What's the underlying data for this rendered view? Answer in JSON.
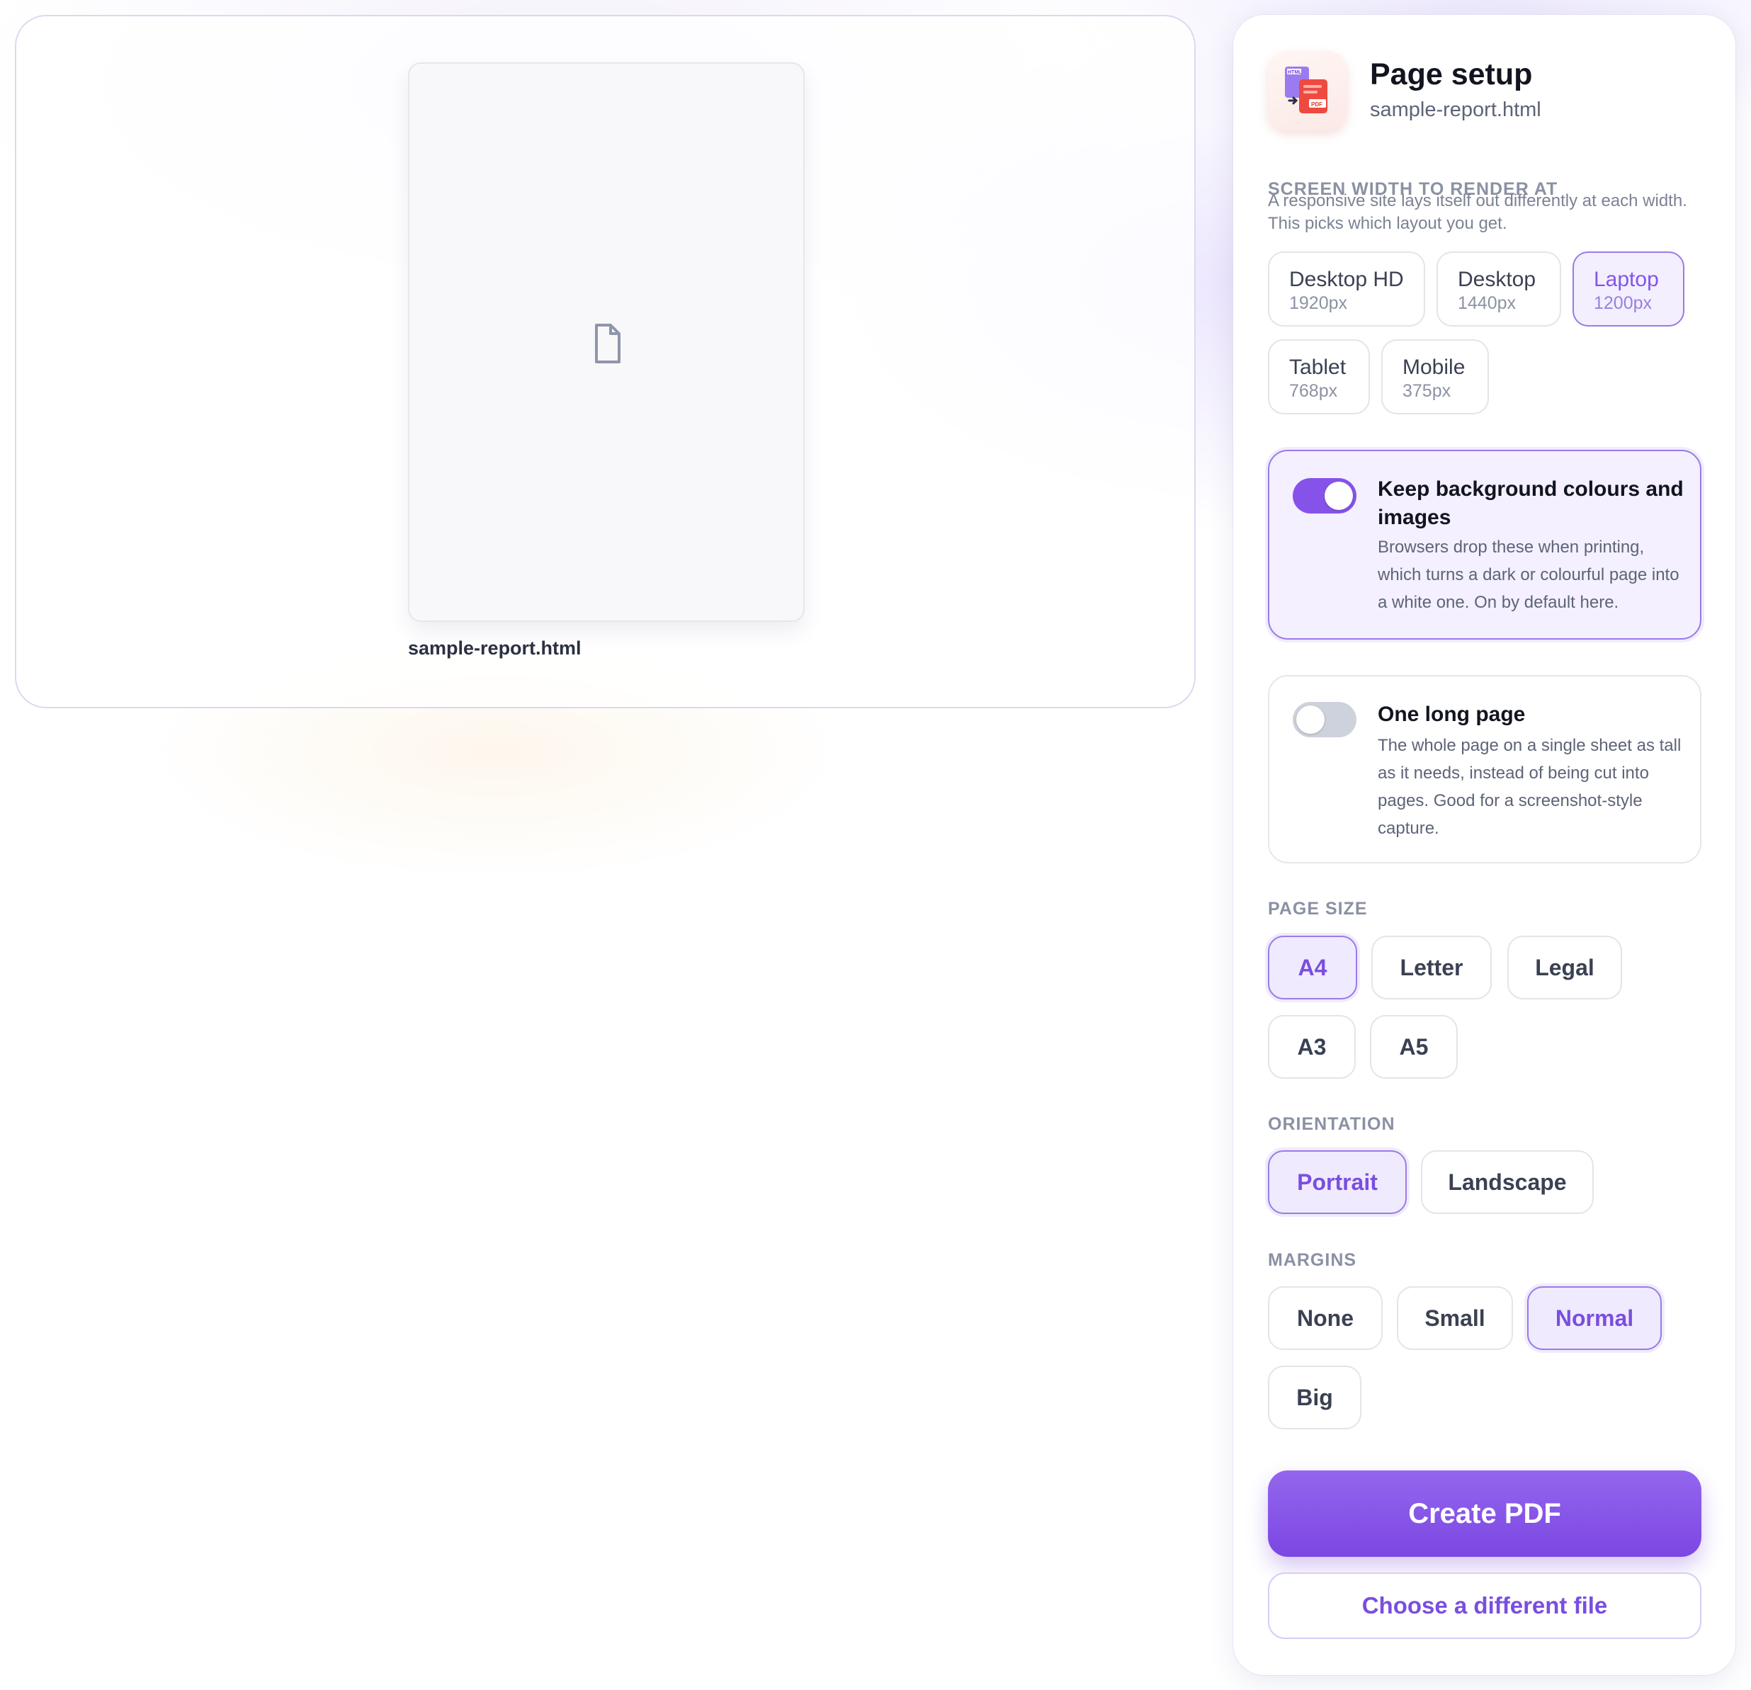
{
  "preview": {
    "filename": "sample-report.html"
  },
  "panel": {
    "title": "Page setup",
    "filename": "sample-report.html"
  },
  "screen_width": {
    "label": "SCREEN WIDTH TO RENDER AT",
    "help": "A responsive site lays itself out differently at each width. This picks which layout you get.",
    "options": [
      {
        "name": "Desktop HD",
        "px": "1920px",
        "selected": false
      },
      {
        "name": "Desktop",
        "px": "1440px",
        "selected": false
      },
      {
        "name": "Laptop",
        "px": "1200px",
        "selected": true
      },
      {
        "name": "Tablet",
        "px": "768px",
        "selected": false
      },
      {
        "name": "Mobile",
        "px": "375px",
        "selected": false
      }
    ]
  },
  "keep_background": {
    "title": "Keep background colours and images",
    "desc": "Browsers drop these when printing, which turns a dark or colourful page into a white one. On by default here.",
    "on": true
  },
  "one_long_page": {
    "title": "One long page",
    "desc": "The whole page on a single sheet as tall as it needs, instead of being cut into pages. Good for a screenshot-style capture.",
    "on": false
  },
  "page_size": {
    "label": "PAGE SIZE",
    "options": [
      "A4",
      "Letter",
      "Legal",
      "A3",
      "A5"
    ],
    "selected": "A4"
  },
  "orientation": {
    "label": "ORIENTATION",
    "options": [
      "Portrait",
      "Landscape"
    ],
    "selected": "Portrait"
  },
  "margins": {
    "label": "MARGINS",
    "options": [
      "None",
      "Small",
      "Normal",
      "Big"
    ],
    "selected": "Normal"
  },
  "actions": {
    "create": "Create PDF",
    "choose": "Choose a different file"
  },
  "colors": {
    "accent": "#7b47e2",
    "accent_light": "#efeafd",
    "toggle_off": "#cdd2dc"
  },
  "icons": {
    "preview_document": "document-icon",
    "app": "html-to-pdf-icon"
  }
}
